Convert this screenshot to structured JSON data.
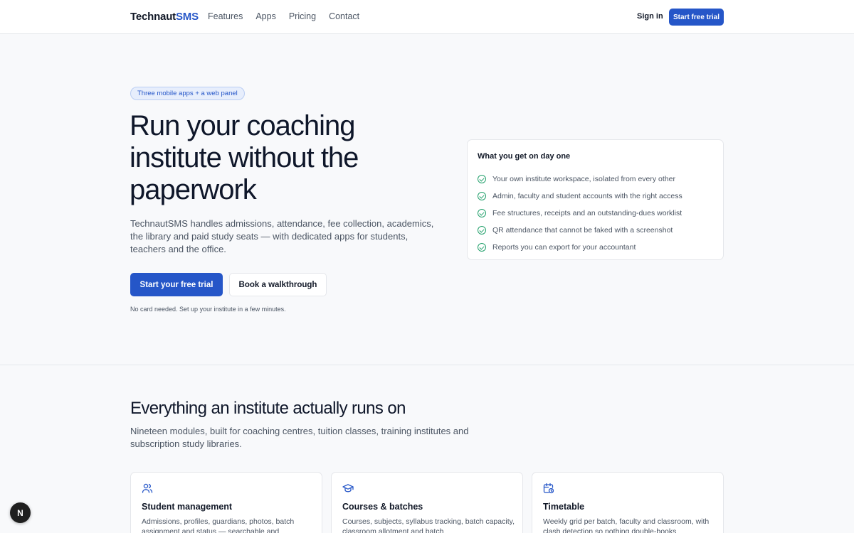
{
  "colors": {
    "accent": "#2556c8",
    "success": "#22a06b",
    "page_bg": "#f8f9fb",
    "text_dark": "#0f172a",
    "text_muted": "#4b5563"
  },
  "nav": {
    "brand_main": "Technaut",
    "brand_accent": "SMS",
    "links": [
      "Features",
      "Apps",
      "Pricing",
      "Contact"
    ],
    "sign_in": "Sign in",
    "cta": "Start free trial"
  },
  "hero": {
    "badge": "Three mobile apps + a web panel",
    "title": "Run your coaching institute without the paperwork",
    "description": "TechnautSMS handles admissions, attendance, fee collection, academics, the library and paid study seats — with dedicated apps for students, teachers and the office.",
    "primary_button": "Start your free trial",
    "secondary_button": "Book a walkthrough",
    "note": "No card needed. Set up your institute in a few minutes."
  },
  "day_one": {
    "title": "What you get on day one",
    "items": [
      "Your own institute workspace, isolated from every other",
      "Admin, faculty and student accounts with the right access",
      "Fee structures, receipts and an outstanding-dues worklist",
      "QR attendance that cannot be faked with a screenshot",
      "Reports you can export for your accountant"
    ]
  },
  "features": {
    "title": "Everything an institute actually runs on",
    "subtitle": "Nineteen modules, built for coaching centres, tuition classes, training institutes and subscription study libraries.",
    "cards": [
      {
        "icon": "users-icon",
        "title": "Student management",
        "description": "Admissions, profiles, guardians, photos, batch assignment and status — searchable and"
      },
      {
        "icon": "graduation-cap-icon",
        "title": "Courses & batches",
        "description": "Courses, subjects, syllabus tracking, batch capacity, classroom allotment and batch"
      },
      {
        "icon": "calendar-clock-icon",
        "title": "Timetable",
        "description": "Weekly grid per batch, faculty and classroom, with clash detection so nothing double-books"
      }
    ]
  },
  "fab": {
    "label": "N"
  }
}
